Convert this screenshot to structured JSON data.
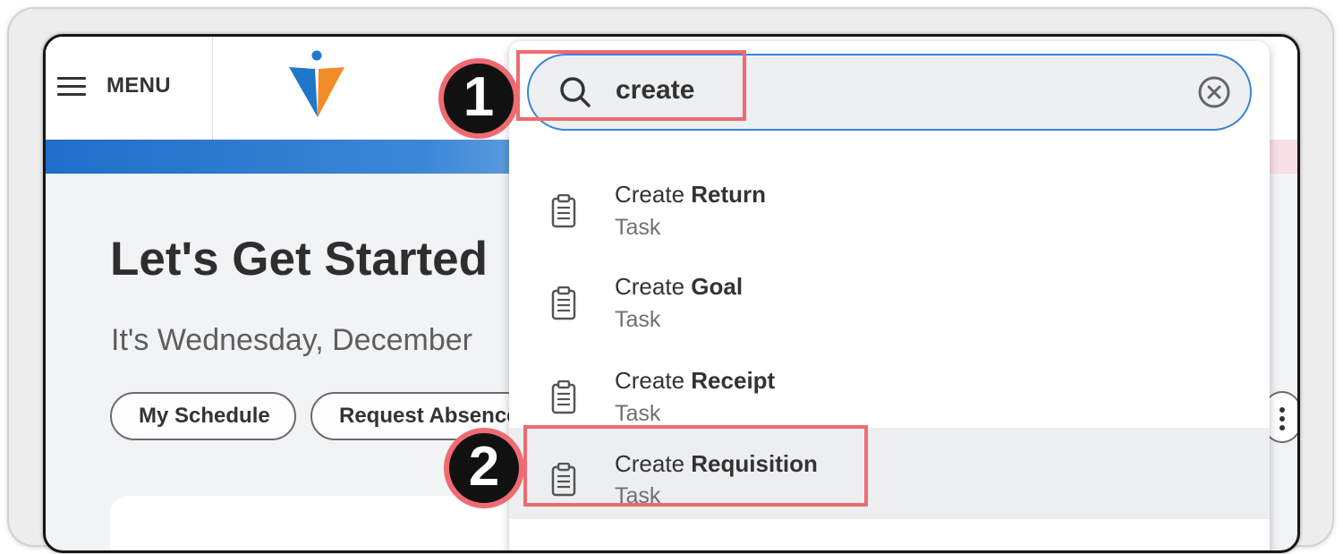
{
  "header": {
    "menu_label": "MENU"
  },
  "home": {
    "title": "Let's Get Started",
    "date_text": "It's Wednesday, December",
    "actions": [
      "My Schedule",
      "Request Absence"
    ]
  },
  "search": {
    "query": "create",
    "results": [
      {
        "prefix": "Create",
        "match": "Return",
        "type": "Task"
      },
      {
        "prefix": "Create",
        "match": "Goal",
        "type": "Task"
      },
      {
        "prefix": "Create",
        "match": "Receipt",
        "type": "Task"
      },
      {
        "prefix": "Create",
        "match": "Requisition",
        "type": "Task"
      }
    ]
  },
  "annotations": {
    "step1": "1",
    "step2": "2"
  },
  "icons": {
    "menu": "hamburger-icon",
    "logo": "workday-logo",
    "search": "search-icon",
    "clear": "clear-circle-x-icon",
    "result": "clipboard-task-icon",
    "more": "more-vertical-icon"
  },
  "colors": {
    "accent_blue": "#3b83d8",
    "annotation_red": "#ee6b72",
    "logo_blue": "#1e77c9",
    "logo_orange": "#f28c28"
  }
}
